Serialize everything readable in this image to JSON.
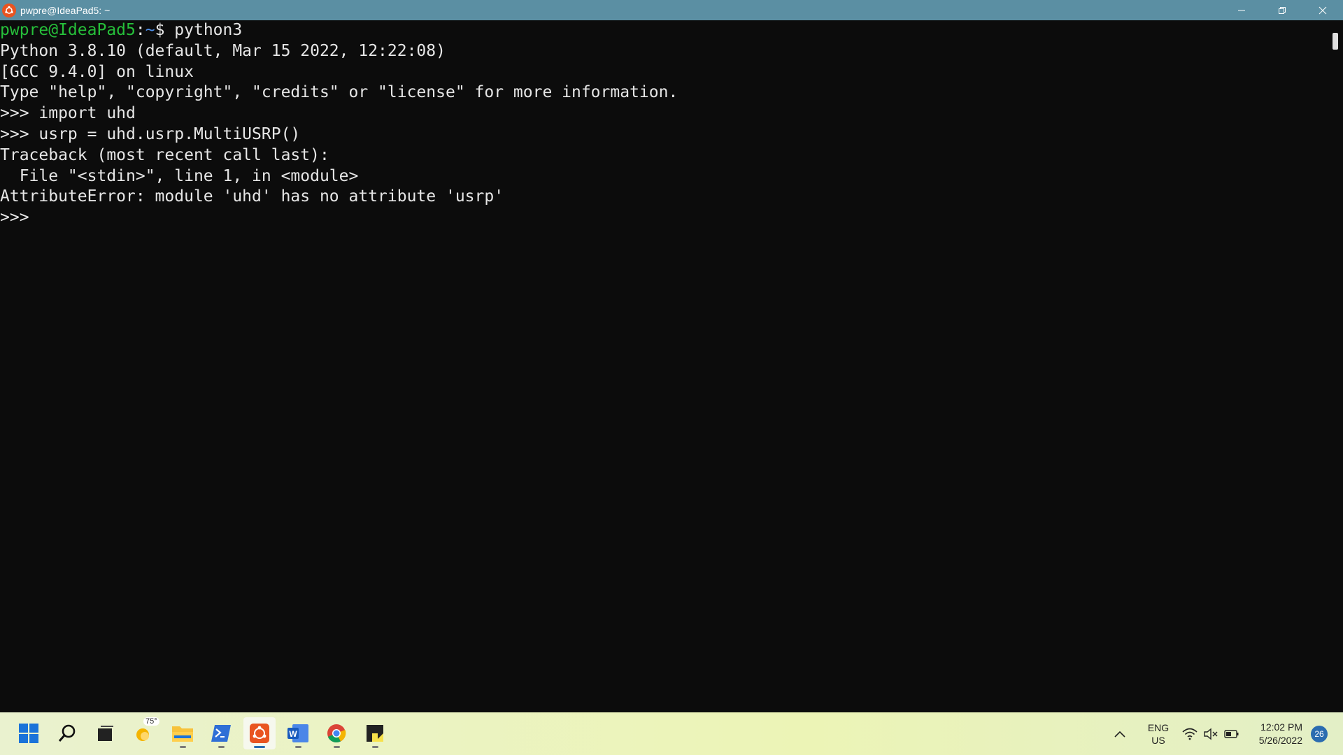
{
  "window": {
    "title": "pwpre@IdeaPad5: ~",
    "controls": {
      "minimize": "minimize-icon",
      "restore": "restore-icon",
      "close": "close-icon"
    }
  },
  "terminal": {
    "prompt_user": "pwpre@IdeaPad5",
    "prompt_path": "~",
    "prompt_cmd": "$ python3",
    "lines": [
      "Python 3.8.10 (default, Mar 15 2022, 12:22:08)",
      "[GCC 9.4.0] on linux",
      "Type \"help\", \"copyright\", \"credits\" or \"license\" for more information.",
      ">>> import uhd",
      ">>> usrp = uhd.usrp.MultiUSRP()",
      "Traceback (most recent call last):",
      "  File \"<stdin>\", line 1, in <module>",
      "AttributeError: module 'uhd' has no attribute 'usrp'",
      ">>> "
    ]
  },
  "taskbar": {
    "apps": [
      {
        "name": "start",
        "icon": "windows-start-icon"
      },
      {
        "name": "search",
        "icon": "search-icon"
      },
      {
        "name": "task-view",
        "icon": "task-view-icon"
      },
      {
        "name": "weather",
        "icon": "weather-sun-icon",
        "temp": "75°"
      },
      {
        "name": "file-explorer",
        "icon": "folder-icon"
      },
      {
        "name": "powershell",
        "icon": "powershell-icon"
      },
      {
        "name": "ubuntu",
        "icon": "ubuntu-icon"
      },
      {
        "name": "word",
        "icon": "word-icon"
      },
      {
        "name": "chrome",
        "icon": "chrome-icon"
      },
      {
        "name": "sticky-notes",
        "icon": "sticky-notes-icon"
      }
    ],
    "tray": {
      "lang_line1": "ENG",
      "lang_line2": "US",
      "time": "12:02 PM",
      "date": "5/26/2022",
      "notifications": "26"
    }
  },
  "colors": {
    "titlebar": "#5b8fa3",
    "terminal_bg": "#0c0c0c",
    "prompt_green": "#26bf3a",
    "prompt_blue": "#4f8fe8",
    "ubuntu_orange": "#e95420"
  }
}
